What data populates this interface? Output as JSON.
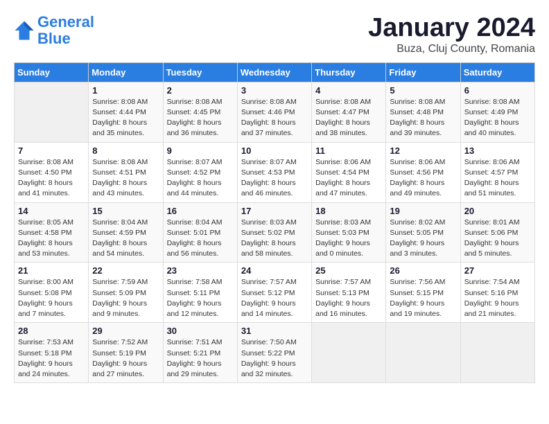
{
  "header": {
    "logo_line1": "General",
    "logo_line2": "Blue",
    "month_title": "January 2024",
    "location": "Buza, Cluj County, Romania"
  },
  "weekdays": [
    "Sunday",
    "Monday",
    "Tuesday",
    "Wednesday",
    "Thursday",
    "Friday",
    "Saturday"
  ],
  "weeks": [
    [
      {
        "day": "",
        "info": ""
      },
      {
        "day": "1",
        "info": "Sunrise: 8:08 AM\nSunset: 4:44 PM\nDaylight: 8 hours\nand 35 minutes."
      },
      {
        "day": "2",
        "info": "Sunrise: 8:08 AM\nSunset: 4:45 PM\nDaylight: 8 hours\nand 36 minutes."
      },
      {
        "day": "3",
        "info": "Sunrise: 8:08 AM\nSunset: 4:46 PM\nDaylight: 8 hours\nand 37 minutes."
      },
      {
        "day": "4",
        "info": "Sunrise: 8:08 AM\nSunset: 4:47 PM\nDaylight: 8 hours\nand 38 minutes."
      },
      {
        "day": "5",
        "info": "Sunrise: 8:08 AM\nSunset: 4:48 PM\nDaylight: 8 hours\nand 39 minutes."
      },
      {
        "day": "6",
        "info": "Sunrise: 8:08 AM\nSunset: 4:49 PM\nDaylight: 8 hours\nand 40 minutes."
      }
    ],
    [
      {
        "day": "7",
        "info": "Sunrise: 8:08 AM\nSunset: 4:50 PM\nDaylight: 8 hours\nand 41 minutes."
      },
      {
        "day": "8",
        "info": "Sunrise: 8:08 AM\nSunset: 4:51 PM\nDaylight: 8 hours\nand 43 minutes."
      },
      {
        "day": "9",
        "info": "Sunrise: 8:07 AM\nSunset: 4:52 PM\nDaylight: 8 hours\nand 44 minutes."
      },
      {
        "day": "10",
        "info": "Sunrise: 8:07 AM\nSunset: 4:53 PM\nDaylight: 8 hours\nand 46 minutes."
      },
      {
        "day": "11",
        "info": "Sunrise: 8:06 AM\nSunset: 4:54 PM\nDaylight: 8 hours\nand 47 minutes."
      },
      {
        "day": "12",
        "info": "Sunrise: 8:06 AM\nSunset: 4:56 PM\nDaylight: 8 hours\nand 49 minutes."
      },
      {
        "day": "13",
        "info": "Sunrise: 8:06 AM\nSunset: 4:57 PM\nDaylight: 8 hours\nand 51 minutes."
      }
    ],
    [
      {
        "day": "14",
        "info": "Sunrise: 8:05 AM\nSunset: 4:58 PM\nDaylight: 8 hours\nand 53 minutes."
      },
      {
        "day": "15",
        "info": "Sunrise: 8:04 AM\nSunset: 4:59 PM\nDaylight: 8 hours\nand 54 minutes."
      },
      {
        "day": "16",
        "info": "Sunrise: 8:04 AM\nSunset: 5:01 PM\nDaylight: 8 hours\nand 56 minutes."
      },
      {
        "day": "17",
        "info": "Sunrise: 8:03 AM\nSunset: 5:02 PM\nDaylight: 8 hours\nand 58 minutes."
      },
      {
        "day": "18",
        "info": "Sunrise: 8:03 AM\nSunset: 5:03 PM\nDaylight: 9 hours\nand 0 minutes."
      },
      {
        "day": "19",
        "info": "Sunrise: 8:02 AM\nSunset: 5:05 PM\nDaylight: 9 hours\nand 3 minutes."
      },
      {
        "day": "20",
        "info": "Sunrise: 8:01 AM\nSunset: 5:06 PM\nDaylight: 9 hours\nand 5 minutes."
      }
    ],
    [
      {
        "day": "21",
        "info": "Sunrise: 8:00 AM\nSunset: 5:08 PM\nDaylight: 9 hours\nand 7 minutes."
      },
      {
        "day": "22",
        "info": "Sunrise: 7:59 AM\nSunset: 5:09 PM\nDaylight: 9 hours\nand 9 minutes."
      },
      {
        "day": "23",
        "info": "Sunrise: 7:58 AM\nSunset: 5:11 PM\nDaylight: 9 hours\nand 12 minutes."
      },
      {
        "day": "24",
        "info": "Sunrise: 7:57 AM\nSunset: 5:12 PM\nDaylight: 9 hours\nand 14 minutes."
      },
      {
        "day": "25",
        "info": "Sunrise: 7:57 AM\nSunset: 5:13 PM\nDaylight: 9 hours\nand 16 minutes."
      },
      {
        "day": "26",
        "info": "Sunrise: 7:56 AM\nSunset: 5:15 PM\nDaylight: 9 hours\nand 19 minutes."
      },
      {
        "day": "27",
        "info": "Sunrise: 7:54 AM\nSunset: 5:16 PM\nDaylight: 9 hours\nand 21 minutes."
      }
    ],
    [
      {
        "day": "28",
        "info": "Sunrise: 7:53 AM\nSunset: 5:18 PM\nDaylight: 9 hours\nand 24 minutes."
      },
      {
        "day": "29",
        "info": "Sunrise: 7:52 AM\nSunset: 5:19 PM\nDaylight: 9 hours\nand 27 minutes."
      },
      {
        "day": "30",
        "info": "Sunrise: 7:51 AM\nSunset: 5:21 PM\nDaylight: 9 hours\nand 29 minutes."
      },
      {
        "day": "31",
        "info": "Sunrise: 7:50 AM\nSunset: 5:22 PM\nDaylight: 9 hours\nand 32 minutes."
      },
      {
        "day": "",
        "info": ""
      },
      {
        "day": "",
        "info": ""
      },
      {
        "day": "",
        "info": ""
      }
    ]
  ]
}
